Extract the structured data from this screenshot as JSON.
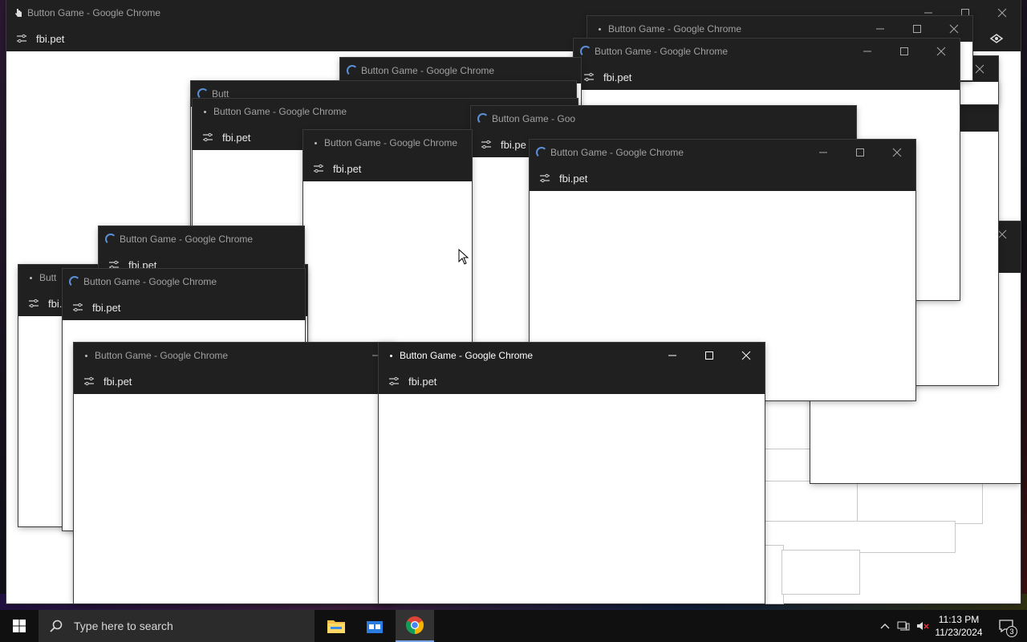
{
  "window_title": "Button Game - Google Chrome",
  "window_title_short": "Butt",
  "window_title_mid": "Button Game - Goo",
  "url": "fbi.pet",
  "url_short": "fbi.pe",
  "taskbar": {
    "search_placeholder": "Type here to search",
    "clock_time": "11:13 PM",
    "clock_date": "11/23/2024",
    "notification_count": "3"
  },
  "colors": {
    "titlebar": "#202020",
    "spinner": "#5a8fd8",
    "taskbar": "#101010"
  },
  "icons": [
    "windows-start-icon",
    "search-icon",
    "file-explorer-icon",
    "store-icon",
    "chrome-icon",
    "chevron-up-icon",
    "network-icon",
    "volume-muted-icon",
    "notification-icon",
    "loading-spinner-icon",
    "site-settings-icon",
    "minimize-icon",
    "maximize-icon",
    "close-icon"
  ]
}
